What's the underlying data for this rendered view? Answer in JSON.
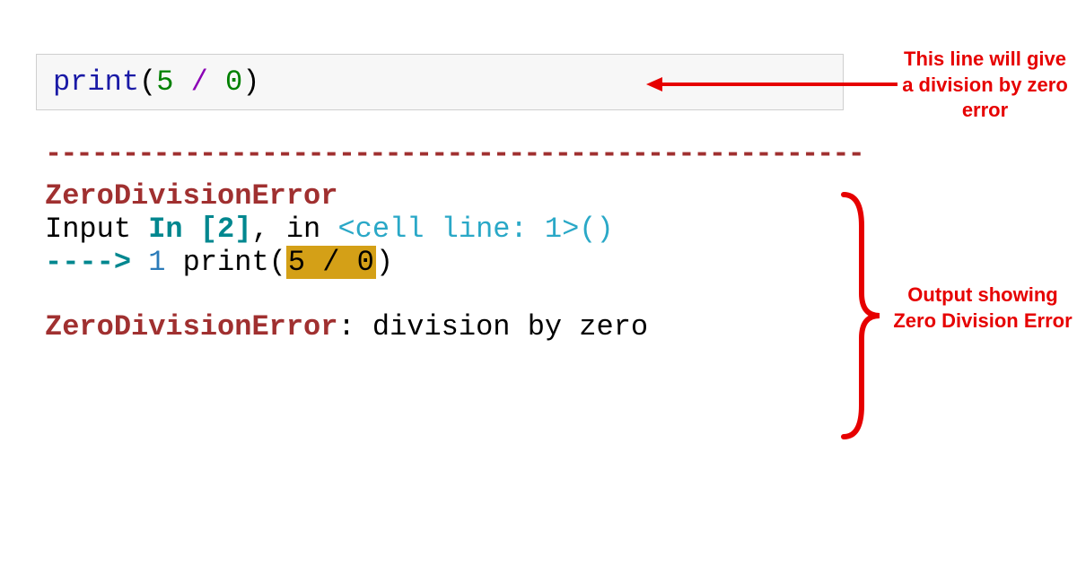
{
  "code_cell": {
    "func": "print",
    "open_paren": "(",
    "num1": "5",
    "space1": " ",
    "op": "/",
    "space2": " ",
    "num2": "0",
    "close_paren": ")"
  },
  "output": {
    "dashes": "---------------------------------------------------------",
    "error_name": "ZeroDivisionError",
    "input_prefix": "Input ",
    "input_in": "In [2]",
    "input_comma": ",",
    "input_in2": " in ",
    "cell_ref": "<cell line: 1>",
    "cell_parens": "()",
    "arrow": "----> ",
    "line_num": "1",
    "print_call": " print(",
    "hl_expr": "5 / 0",
    "close_p": ")",
    "final_name": "ZeroDivisionError",
    "final_colon": ": ",
    "final_msg": "division by zero"
  },
  "annotations": {
    "top": "This line will give a division by zero error",
    "middle": "Output showing Zero Division Error"
  }
}
